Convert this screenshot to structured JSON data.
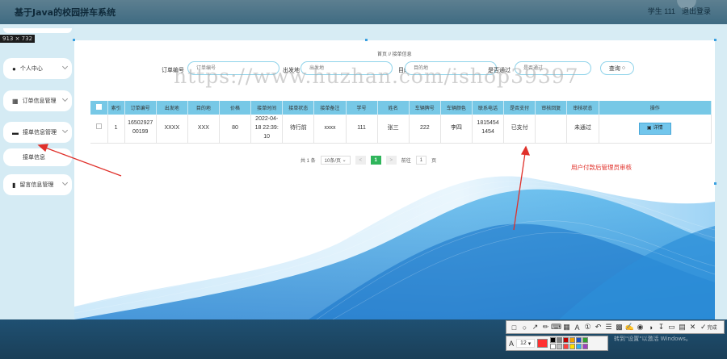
{
  "app_title": "基于Java的校园拼车系统",
  "user": {
    "label": "学生 111",
    "logout": "退出登录"
  },
  "capture_size": "913 × 732",
  "sidebar": {
    "items": [
      {
        "label": "个人中心",
        "icon": "user-icon"
      },
      {
        "label": "订单信息管理",
        "icon": "grid-icon"
      },
      {
        "label": "接单信息管理",
        "icon": "car-icon"
      },
      {
        "label": "留言信息管理",
        "icon": "chat-icon"
      }
    ],
    "sub_item": "接单信息"
  },
  "breadcrumb": "首页 // 接单信息",
  "search": {
    "fields": [
      {
        "label": "订单编号",
        "placeholder": "订单编号"
      },
      {
        "label": "出发地",
        "placeholder": "出发地"
      },
      {
        "label": "目的地",
        "placeholder": "目的地"
      },
      {
        "label": "是否通过",
        "placeholder": "是否通过"
      }
    ],
    "button": "查询"
  },
  "table": {
    "headers": [
      "索引",
      "订单编号",
      "出发地",
      "目的地",
      "价格",
      "接单时间",
      "接单状态",
      "接单备注",
      "学号",
      "姓名",
      "车辆牌号",
      "车辆颜色",
      "联系电话",
      "是否支付",
      "审核回复",
      "审核状态",
      "操作"
    ],
    "rows": [
      {
        "index": "1",
        "order_no_1": "16502927",
        "order_no_2": "00199",
        "from": "XXXX",
        "to": "XXX",
        "price": "80",
        "time_1": "2022-04-",
        "time_2": "18 22:39:",
        "time_3": "10",
        "status": "待行前",
        "remark": "xxxx",
        "student_no": "111",
        "name": "张三",
        "plate": "222",
        "color": "李四",
        "phone_1": "1815454",
        "phone_2": "1454",
        "paid": "已支付",
        "reply": "",
        "audit": "未通过",
        "action": "详情"
      }
    ]
  },
  "pagination": {
    "total": "共 1 条",
    "page_size": "10条/页",
    "prev": "<",
    "current": "1",
    "next": ">",
    "goto_label": "前往",
    "goto_value": "1",
    "page_suffix": "页"
  },
  "annotation": "用户付款后管理员审核",
  "watermark": "https://www.huzhan.com/ishop39397",
  "toolbar": {
    "done": "完成",
    "font_size": "12",
    "font_label": "A"
  },
  "windows_notice": "转到\"设置\"以激活 Windows。",
  "colors": {
    "accent": "#77c8e6",
    "annotation": "#e0302a",
    "pager_current": "#2fb55b"
  }
}
